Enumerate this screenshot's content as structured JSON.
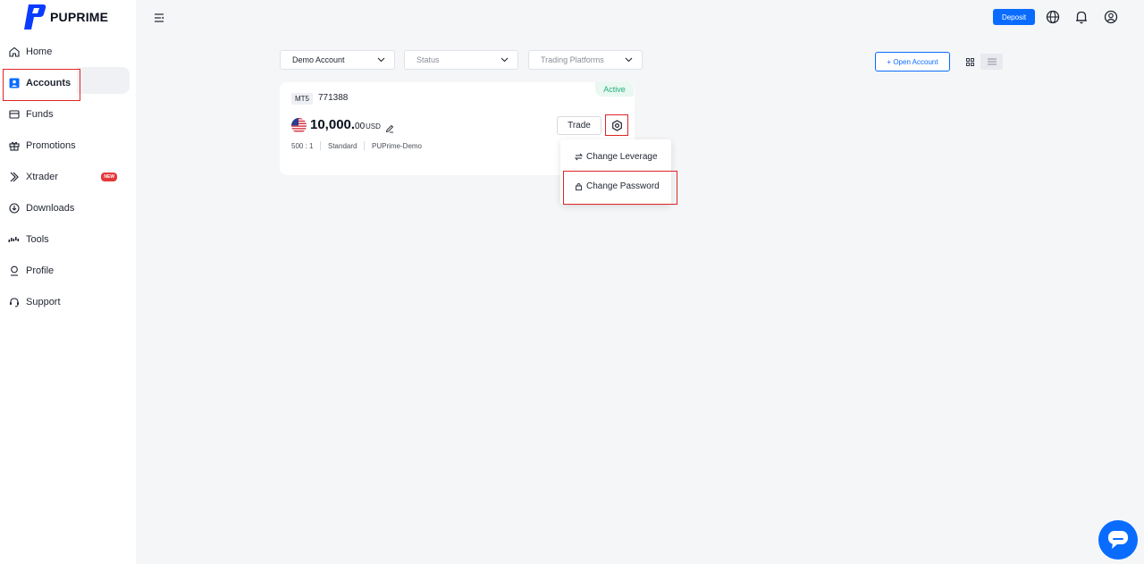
{
  "brand": {
    "name": "PUPRIME",
    "color": "#0a3cff"
  },
  "sidebar": {
    "items": [
      {
        "label": "Home",
        "icon": "home-icon"
      },
      {
        "label": "Accounts",
        "icon": "accounts-icon",
        "active": true
      },
      {
        "label": "Funds",
        "icon": "funds-icon"
      },
      {
        "label": "Promotions",
        "icon": "gift-icon"
      },
      {
        "label": "Xtrader",
        "icon": "xtrader-icon",
        "badge": "NEW"
      },
      {
        "label": "Downloads",
        "icon": "download-icon"
      },
      {
        "label": "Tools",
        "icon": "tools-icon"
      },
      {
        "label": "Profile",
        "icon": "profile-icon"
      },
      {
        "label": "Support",
        "icon": "headset-icon"
      }
    ]
  },
  "topbar": {
    "deposit_label": "Deposit"
  },
  "filters": {
    "account_type": "Demo Account",
    "status": "Status",
    "platforms": "Trading Platforms"
  },
  "actions": {
    "open_account_label": "+ Open Account"
  },
  "account": {
    "platform": "MT5",
    "number": "771388",
    "status": "Active",
    "balance_int": "10,000.",
    "balance_dec": "00",
    "currency": "USD",
    "leverage": "500 : 1",
    "type": "Standard",
    "server": "PUPrime-Demo",
    "trade_label": "Trade"
  },
  "settings_menu": {
    "items": [
      {
        "label": "Change Leverage",
        "icon": "swap-icon"
      },
      {
        "label": "Change Password",
        "icon": "lock-icon"
      }
    ]
  },
  "colors": {
    "accent": "#0a6cff",
    "active_status": "#23b07d",
    "highlight": "#e02424"
  }
}
